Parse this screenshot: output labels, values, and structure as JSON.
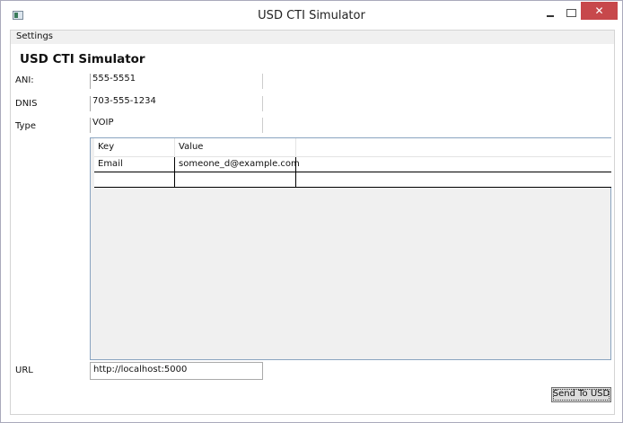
{
  "window": {
    "title": "USD CTI Simulator",
    "close_glyph": "✕"
  },
  "menu": {
    "settings": "Settings"
  },
  "heading": "USD CTI Simulator",
  "fields": {
    "ani": {
      "label": "ANI:",
      "value": "555-5551"
    },
    "dnis": {
      "label": "DNIS",
      "value": "703-555-1234"
    },
    "type": {
      "label": "Type",
      "value": "VOIP"
    }
  },
  "grid": {
    "columns": [
      "Key",
      "Value"
    ],
    "rows": [
      {
        "key": "Email",
        "value": "someone_d@example.com"
      },
      {
        "key": "",
        "value": ""
      }
    ]
  },
  "url": {
    "label": "URL",
    "value": "http://localhost:5000"
  },
  "send_button": "Send To USD"
}
